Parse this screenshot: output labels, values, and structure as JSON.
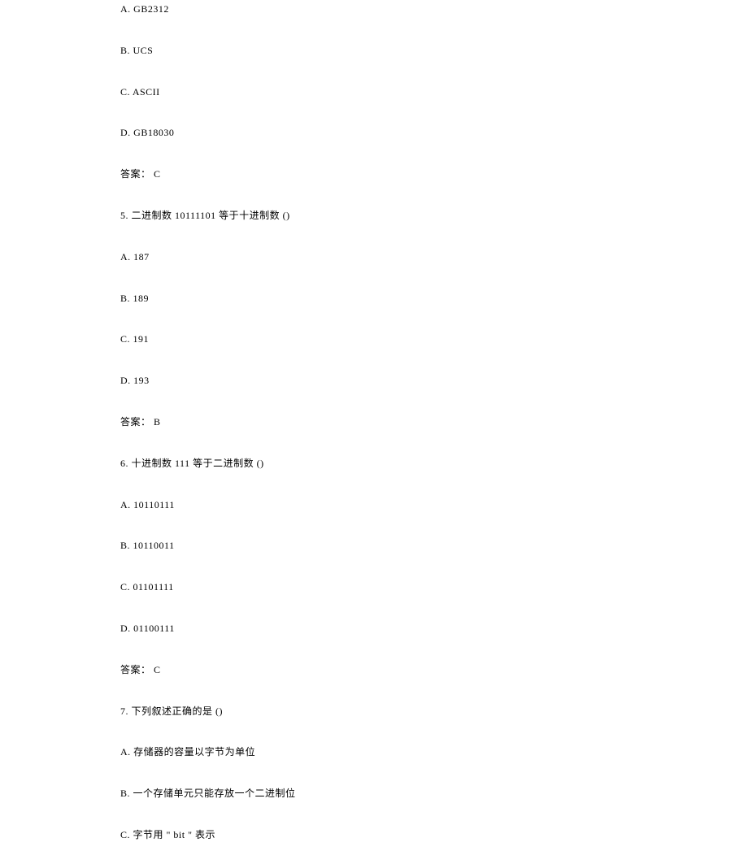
{
  "lines": [
    "A. GB2312",
    "B. UCS",
    "C. ASCII",
    "D. GB18030",
    "答案： C",
    "5.  二进制数 10111101 等于十进制数 ()",
    "A. 187",
    "B. 189",
    "C. 191",
    "D. 193",
    "答案： B",
    "6.  十进制数 111 等于二进制数 ()",
    "A. 10110111",
    "B. 10110011",
    "C. 01101111",
    "D. 01100111",
    "答案： C",
    "7.  下列叙述正确的是 ()",
    "A.  存储器的容量以字节为单位",
    "B.  一个存储单元只能存放一个二进制位",
    "C.  字节用 \" bit \" 表示"
  ]
}
